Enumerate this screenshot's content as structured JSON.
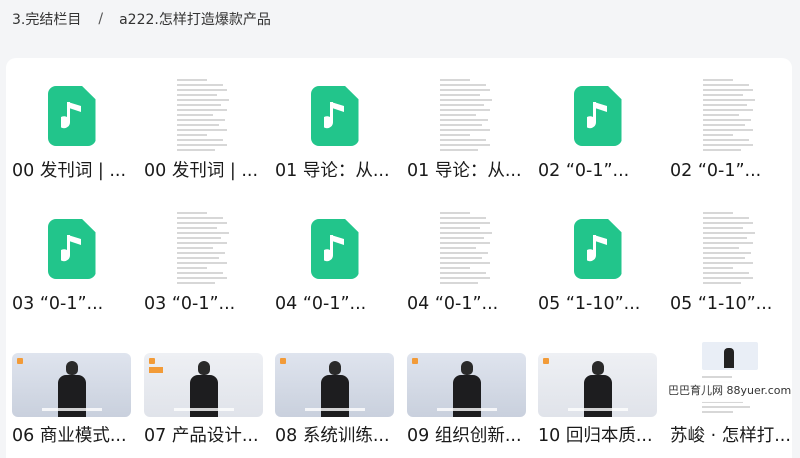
{
  "breadcrumb": {
    "parent": "3.完结栏目",
    "separator": "/",
    "current": "a222.怎样打造爆款产品"
  },
  "watermark": "巴巴育儿网 88yuer.com",
  "colors": {
    "audio_icon": "#22c58b",
    "accent_orange": "#f29b38"
  },
  "files": [
    {
      "label": "00 发刊词 | ...",
      "kind": "audio"
    },
    {
      "label": "00 发刊词 | ...",
      "kind": "doc"
    },
    {
      "label": "01 导论：从...",
      "kind": "audio"
    },
    {
      "label": "01 导论：从...",
      "kind": "doc"
    },
    {
      "label": "02 “0-1”...",
      "kind": "audio"
    },
    {
      "label": "02 “0-1”...",
      "kind": "doc"
    },
    {
      "label": "03 “0-1”...",
      "kind": "audio"
    },
    {
      "label": "03 “0-1”...",
      "kind": "doc"
    },
    {
      "label": "04 “0-1”...",
      "kind": "audio"
    },
    {
      "label": "04 “0-1”...",
      "kind": "doc"
    },
    {
      "label": "05 “1-10”...",
      "kind": "audio"
    },
    {
      "label": "05 “1-10”...",
      "kind": "doc"
    },
    {
      "label": "06 商业模式...",
      "kind": "video"
    },
    {
      "label": "07 产品设计...",
      "kind": "video"
    },
    {
      "label": "08 系统训练...",
      "kind": "video"
    },
    {
      "label": "09 组织创新...",
      "kind": "video"
    },
    {
      "label": "10 回归本质...",
      "kind": "video"
    },
    {
      "label": "苏峻 · 怎样打...",
      "kind": "image"
    }
  ]
}
